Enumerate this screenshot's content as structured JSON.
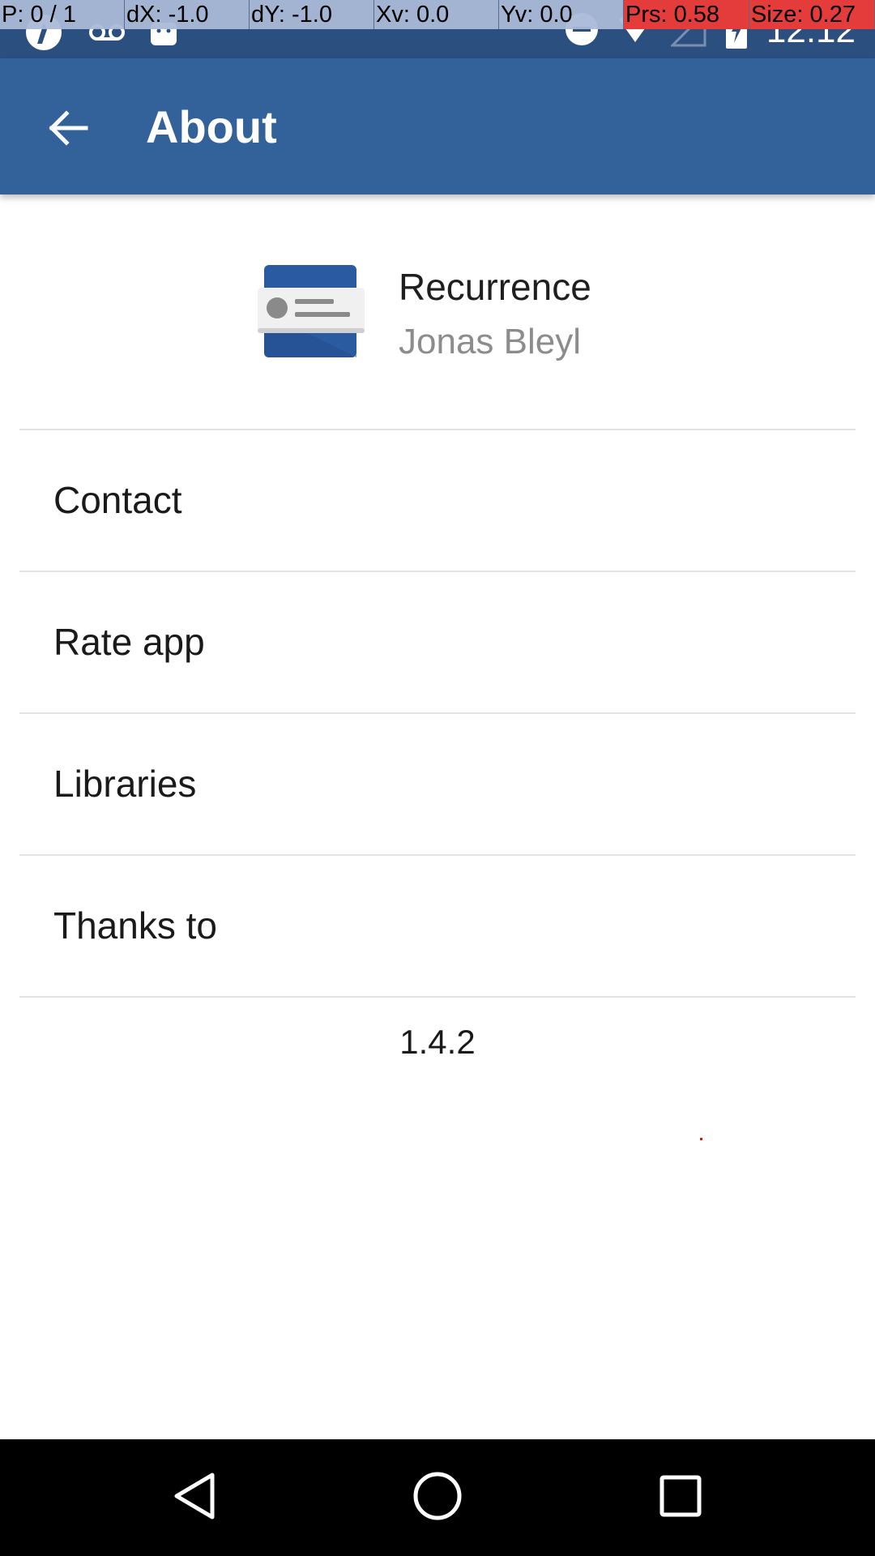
{
  "debug_overlay": {
    "p": "P: 0 / 1",
    "dx": "dX: -1.0",
    "dy": "dY: -1.0",
    "xv": "Xv: 0.0",
    "yv": "Yv: 0.0",
    "prs": "Prs: 0.58",
    "size": "Size: 0.27"
  },
  "status_bar": {
    "time": "12:12",
    "icons": [
      "app-notification-icon",
      "voicemail-icon",
      "android-icon",
      "do-not-disturb-icon",
      "wifi-icon",
      "signal-icon",
      "battery-charging-icon"
    ]
  },
  "app_bar": {
    "title": "About",
    "back_icon": "arrow-back-icon"
  },
  "app_info": {
    "name": "Recurrence",
    "author": "Jonas Bleyl",
    "icon": "recurrence-app-icon"
  },
  "menu": {
    "items": [
      {
        "label": "Contact"
      },
      {
        "label": "Rate app"
      },
      {
        "label": "Libraries"
      },
      {
        "label": "Thanks to"
      }
    ]
  },
  "version": "1.4.2",
  "nav_bar": {
    "icons": [
      "back-nav-icon",
      "home-nav-icon",
      "recents-nav-icon"
    ]
  },
  "colors": {
    "status_bar": "#2b5080",
    "app_bar": "#33619a",
    "divider": "#e3e3e3",
    "author_text": "#8c8c8c"
  }
}
